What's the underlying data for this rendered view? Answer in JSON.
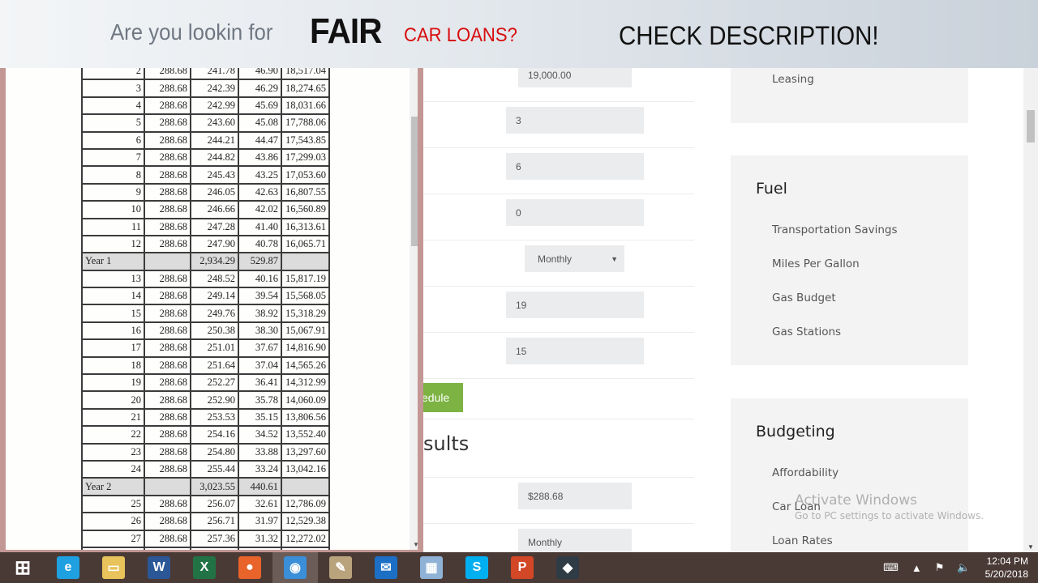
{
  "banner": {
    "question": "Are you lookin for",
    "fair": "FAIR",
    "car_loans": "CAR LOANS?",
    "check": "CHECK DESCRIPTION!"
  },
  "schedule": {
    "rows": [
      {
        "type": "payment",
        "n": "2",
        "payment": "288.68",
        "principal": "241.78",
        "interest": "46.90",
        "balance": "18,517.04"
      },
      {
        "type": "payment",
        "n": "3",
        "payment": "288.68",
        "principal": "242.39",
        "interest": "46.29",
        "balance": "18,274.65"
      },
      {
        "type": "payment",
        "n": "4",
        "payment": "288.68",
        "principal": "242.99",
        "interest": "45.69",
        "balance": "18,031.66"
      },
      {
        "type": "payment",
        "n": "5",
        "payment": "288.68",
        "principal": "243.60",
        "interest": "45.08",
        "balance": "17,788.06"
      },
      {
        "type": "payment",
        "n": "6",
        "payment": "288.68",
        "principal": "244.21",
        "interest": "44.47",
        "balance": "17,543.85"
      },
      {
        "type": "payment",
        "n": "7",
        "payment": "288.68",
        "principal": "244.82",
        "interest": "43.86",
        "balance": "17,299.03"
      },
      {
        "type": "payment",
        "n": "8",
        "payment": "288.68",
        "principal": "245.43",
        "interest": "43.25",
        "balance": "17,053.60"
      },
      {
        "type": "payment",
        "n": "9",
        "payment": "288.68",
        "principal": "246.05",
        "interest": "42.63",
        "balance": "16,807.55"
      },
      {
        "type": "payment",
        "n": "10",
        "payment": "288.68",
        "principal": "246.66",
        "interest": "42.02",
        "balance": "16,560.89"
      },
      {
        "type": "payment",
        "n": "11",
        "payment": "288.68",
        "principal": "247.28",
        "interest": "41.40",
        "balance": "16,313.61"
      },
      {
        "type": "payment",
        "n": "12",
        "payment": "288.68",
        "principal": "247.90",
        "interest": "40.78",
        "balance": "16,065.71"
      },
      {
        "type": "year",
        "n": "Year 1",
        "payment": "",
        "principal": "2,934.29",
        "interest": "529.87",
        "balance": ""
      },
      {
        "type": "payment",
        "n": "13",
        "payment": "288.68",
        "principal": "248.52",
        "interest": "40.16",
        "balance": "15,817.19"
      },
      {
        "type": "payment",
        "n": "14",
        "payment": "288.68",
        "principal": "249.14",
        "interest": "39.54",
        "balance": "15,568.05"
      },
      {
        "type": "payment",
        "n": "15",
        "payment": "288.68",
        "principal": "249.76",
        "interest": "38.92",
        "balance": "15,318.29"
      },
      {
        "type": "payment",
        "n": "16",
        "payment": "288.68",
        "principal": "250.38",
        "interest": "38.30",
        "balance": "15,067.91"
      },
      {
        "type": "payment",
        "n": "17",
        "payment": "288.68",
        "principal": "251.01",
        "interest": "37.67",
        "balance": "14,816.90"
      },
      {
        "type": "payment",
        "n": "18",
        "payment": "288.68",
        "principal": "251.64",
        "interest": "37.04",
        "balance": "14,565.26"
      },
      {
        "type": "payment",
        "n": "19",
        "payment": "288.68",
        "principal": "252.27",
        "interest": "36.41",
        "balance": "14,312.99"
      },
      {
        "type": "payment",
        "n": "20",
        "payment": "288.68",
        "principal": "252.90",
        "interest": "35.78",
        "balance": "14,060.09"
      },
      {
        "type": "payment",
        "n": "21",
        "payment": "288.68",
        "principal": "253.53",
        "interest": "35.15",
        "balance": "13,806.56"
      },
      {
        "type": "payment",
        "n": "22",
        "payment": "288.68",
        "principal": "254.16",
        "interest": "34.52",
        "balance": "13,552.40"
      },
      {
        "type": "payment",
        "n": "23",
        "payment": "288.68",
        "principal": "254.80",
        "interest": "33.88",
        "balance": "13,297.60"
      },
      {
        "type": "payment",
        "n": "24",
        "payment": "288.68",
        "principal": "255.44",
        "interest": "33.24",
        "balance": "13,042.16"
      },
      {
        "type": "year",
        "n": "Year 2",
        "payment": "",
        "principal": "3,023.55",
        "interest": "440.61",
        "balance": ""
      },
      {
        "type": "payment",
        "n": "25",
        "payment": "288.68",
        "principal": "256.07",
        "interest": "32.61",
        "balance": "12,786.09"
      },
      {
        "type": "payment",
        "n": "26",
        "payment": "288.68",
        "principal": "256.71",
        "interest": "31.97",
        "balance": "12,529.38"
      },
      {
        "type": "payment",
        "n": "27",
        "payment": "288.68",
        "principal": "257.36",
        "interest": "31.32",
        "balance": "12,272.02"
      },
      {
        "type": "payment",
        "n": "",
        "payment": "",
        "principal": "",
        "interest": "",
        "balance": ""
      }
    ]
  },
  "form": {
    "loan_amount": "19,000.00",
    "field_2": "3",
    "field_3": "6",
    "field_4": "0",
    "frequency": "Monthly",
    "field_6": "19",
    "field_7": "15",
    "schedule_button_partial": "edule",
    "results_heading_partial": "sults",
    "result_payment": "$288.68",
    "result_frequency": "Monthly"
  },
  "sidebar": {
    "box1": {
      "items": [
        "Leasing"
      ]
    },
    "fuel": {
      "title": "Fuel",
      "items": [
        "Transportation Savings",
        "Miles Per Gallon",
        "Gas Budget",
        "Gas Stations"
      ]
    },
    "budgeting": {
      "title": "Budgeting",
      "items": [
        "Affordability",
        "Car Loan",
        "Loan Rates"
      ]
    }
  },
  "watermark": {
    "line1": "Activate Windows",
    "line2": "Go to PC settings to activate Windows."
  },
  "taskbar": {
    "apps": [
      {
        "name": "start",
        "glyph": "⊞",
        "color": "transparent"
      },
      {
        "name": "internet-explorer",
        "glyph": "e",
        "color": "#1fa0e0"
      },
      {
        "name": "file-explorer",
        "glyph": "▭",
        "color": "#e8c25a"
      },
      {
        "name": "word",
        "glyph": "W",
        "color": "#2b5797"
      },
      {
        "name": "excel",
        "glyph": "X",
        "color": "#217346"
      },
      {
        "name": "firefox",
        "glyph": "●",
        "color": "#e8642a"
      },
      {
        "name": "chrome",
        "glyph": "◉",
        "color": "#3b8ed8"
      },
      {
        "name": "paint",
        "glyph": "✎",
        "color": "#b9a37d"
      },
      {
        "name": "mail",
        "glyph": "✉",
        "color": "#1c6fc4"
      },
      {
        "name": "calculator",
        "glyph": "▦",
        "color": "#8fb2d6"
      },
      {
        "name": "skype",
        "glyph": "S",
        "color": "#00aff0"
      },
      {
        "name": "powerpoint",
        "glyph": "P",
        "color": "#d24726"
      },
      {
        "name": "filmora",
        "glyph": "◆",
        "color": "#2f3b45"
      }
    ],
    "time": "12:04 PM",
    "date": "5/20/2018"
  }
}
